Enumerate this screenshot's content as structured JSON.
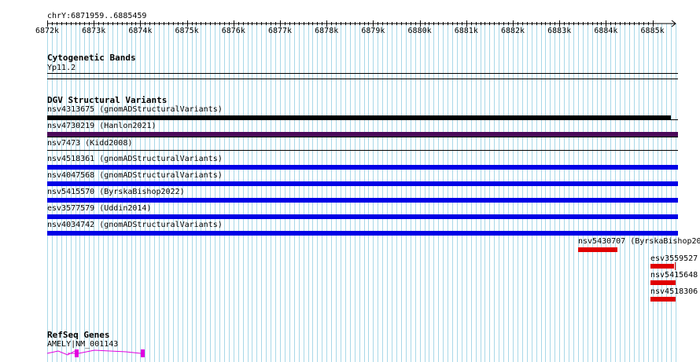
{
  "colors": {
    "grid": "#a8d8e8",
    "black": "#000000",
    "purple": "#4b0a5a",
    "blue": "#0000e6",
    "red": "#e00000",
    "gene": "#e000e0"
  },
  "ruler": {
    "position_label": "chrY:6871959..6885459",
    "ticks": [
      "6872k",
      "6873k",
      "6874k",
      "6875k",
      "6876k",
      "6877k",
      "6878k",
      "6879k",
      "6880k",
      "6881k",
      "6882k",
      "6883k",
      "6884k",
      "6885k"
    ]
  },
  "tracks": {
    "cytogenetic": {
      "title": "Cytogenetic Bands",
      "band_label": "Yp11.2"
    },
    "dgv": {
      "title": "DGV Structural Variants",
      "features": [
        {
          "label": "nsv4313675 (gnomADStructuralVariants)",
          "color": "black"
        },
        {
          "label": "nsv4730219 (Hanlon2021)",
          "color": "purple"
        },
        {
          "label": "nsv7473 (Kidd2008)",
          "color": "none"
        },
        {
          "label": "nsv4518361 (gnomADStructuralVariants)",
          "color": "blue"
        },
        {
          "label": "nsv4047568 (gnomADStructuralVariants)",
          "color": "blue"
        },
        {
          "label": "nsv5415570 (ByrskaBishop2022)",
          "color": "blue"
        },
        {
          "label": "esv3577579 (Uddin2014)",
          "color": "blue"
        },
        {
          "label": "nsv4034742 (gnomADStructuralVariants)",
          "color": "blue"
        },
        {
          "label": "nsv5430707 (ByrskaBishop20",
          "color": "red"
        },
        {
          "label": "esv3559527",
          "color": "red"
        },
        {
          "label": "nsv5415648",
          "color": "red"
        },
        {
          "label": "nsv4518306",
          "color": "red"
        }
      ]
    },
    "refseq": {
      "title": "RefSeq Genes",
      "gene_label": "AMELY|NM_001143"
    }
  }
}
